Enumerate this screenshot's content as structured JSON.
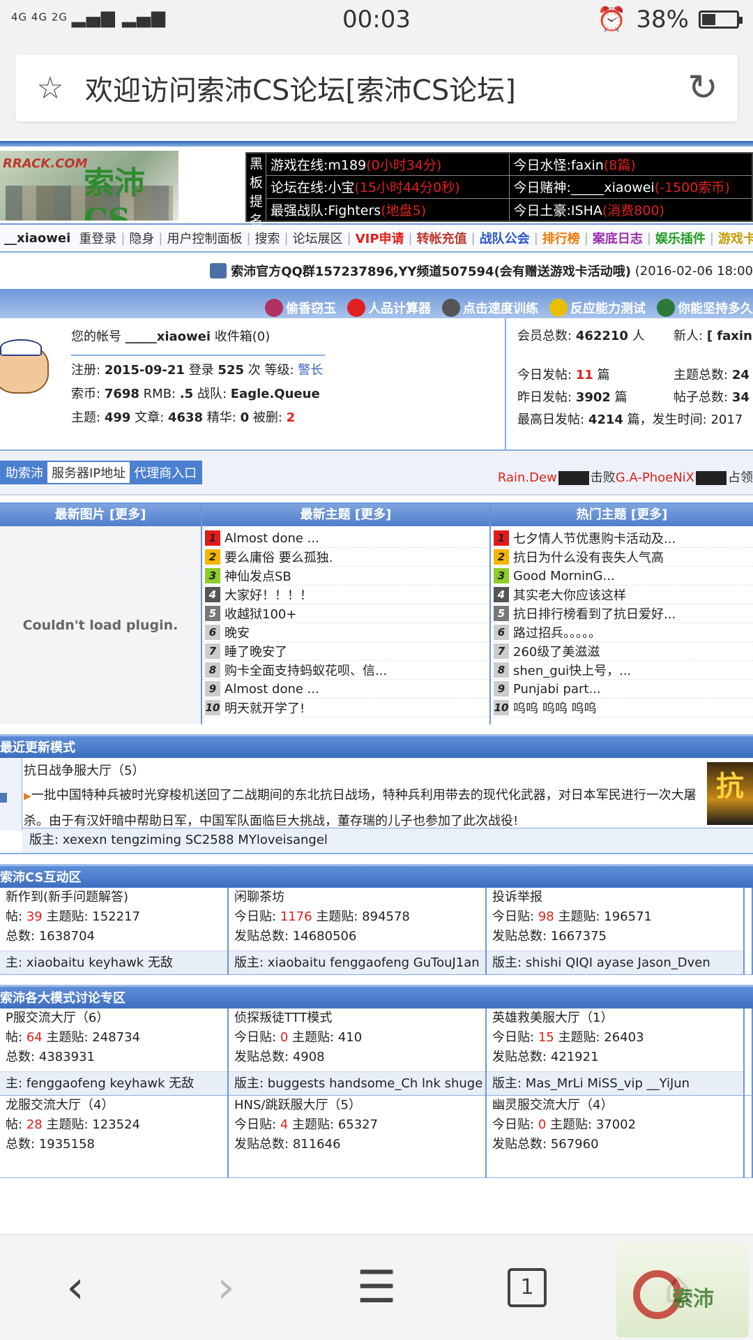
{
  "status": {
    "network": "4G 4G 2G",
    "time": "00:03",
    "battery": "38%",
    "battery_level": 0.38
  },
  "browser": {
    "title": "欢迎访问索沛CS论坛[索沛CS论坛]",
    "tab_count": "1"
  },
  "logo": {
    "url_text": "RRACK.COM",
    "name": "索沛CS"
  },
  "blackboard": {
    "label": [
      "黑",
      "板",
      "提",
      "名"
    ],
    "left": [
      {
        "k": "游戏在线:m189",
        "v": "(0小时34分)"
      },
      {
        "k": "论坛在线:小宝",
        "v": "(15小时44分0秒)"
      },
      {
        "k": "最强战队:Fighters",
        "v": "(地盘5)"
      }
    ],
    "right": [
      {
        "k": "今日水怪:faxin",
        "v": "(8篇)"
      },
      {
        "k": "今日赌神:_____xiaowei",
        "v": "(-1500索币)"
      },
      {
        "k": "今日土豪:ISHA",
        "v": "(消费800)"
      }
    ]
  },
  "nav": {
    "user": "__xiaowei",
    "items": [
      {
        "label": "重登录",
        "color": "#333333"
      },
      {
        "label": "隐身",
        "color": "#333333"
      },
      {
        "label": "用户控制面板",
        "color": "#333333"
      },
      {
        "label": "搜索",
        "color": "#333333"
      },
      {
        "label": "论坛展区",
        "color": "#333333"
      },
      {
        "label": "VIP申请",
        "color": "#e0201b"
      },
      {
        "label": "转帐充值",
        "color": "#c0392b"
      },
      {
        "label": "战队公会",
        "color": "#2a55c8"
      },
      {
        "label": "排行榜",
        "color": "#ee7a00"
      },
      {
        "label": "案底日志",
        "color": "#9b2fae"
      },
      {
        "label": "娱乐插件",
        "color": "#1e9e1e"
      },
      {
        "label": "游戏卡",
        "color": "#c8a000"
      }
    ]
  },
  "notice": {
    "text": "索沛官方QQ群157237896,YY频道507594(会有赠送游戏卡活动哦)",
    "date": "(2016-02-06 18:00"
  },
  "links": [
    "偷香窃玉",
    "人品计算器",
    "点击速度训练",
    "反应能力测试",
    "你能坚持多久"
  ],
  "account": {
    "label": "您的帐号",
    "name": "_____xiaowei",
    "inbox": "收件箱(0)",
    "reg_label": "注册:",
    "reg": "2015-09-21",
    "login_label": "登录",
    "logins": "525",
    "times_label": "次 等级:",
    "rank": "警长",
    "coin_label": "索币:",
    "coins": "7698",
    "rmb_label": "RMB:",
    "rmb": ".5",
    "team_label": "战队:",
    "team": "Eagle.Queue",
    "topics_label": "主题:",
    "topics": "499",
    "articles_label": "文章:",
    "articles": "4638",
    "elite_label": "精华:",
    "elite": "0",
    "deleted_label": "被删:",
    "deleted": "2"
  },
  "forum_stats": {
    "members_label": "会员总数:",
    "members": "462210",
    "members_unit": "人",
    "new_label": "新人:",
    "new_user": "[ faxin",
    "today_label": "今日发帖:",
    "today": "11",
    "today_unit": "篇",
    "topics_total_label": "主题总数:",
    "topics_total": "24",
    "yesterday_label": "昨日发帖:",
    "yesterday": "3902",
    "yesterday_unit": "篇",
    "posts_total_label": "帖子总数:",
    "posts_total": "34",
    "max_label": "最高日发帖:",
    "max": "4214",
    "max_unit": "篇，发生时间:",
    "max_time": "2017"
  },
  "tabs": [
    "助索沛",
    "服务器IP地址",
    "代理商入口"
  ],
  "pk": {
    "a": "Rain.Dew",
    "verb": "击败",
    "b": "G.A-PhoeNiX",
    "tail": "占领"
  },
  "latest_images": {
    "title": "最新图片 [更多]",
    "plugin": "Couldn't load plugin."
  },
  "latest_topics": {
    "title": "最新主题 [更多]",
    "items": [
      "Almost done ...",
      "要么庸俗 要么孤独.",
      "神仙发点SB",
      "大家好！！！！",
      "收越狱100+",
      "晚安",
      "睡了晚安了",
      "购卡全面支持蚂蚁花呗、信...",
      "Almost done ...",
      "明天就开学了!"
    ]
  },
  "hot_topics": {
    "title": "热门主题 [更多]",
    "items": [
      "七夕情人节优惠购卡活动及...",
      "抗日为什么没有丧失人气高",
      "Good MorninG...",
      "其实老大你应该这样",
      "抗日排行榜看到了抗日爱好...",
      "路过招兵。。。。。",
      "260级了美滋滋",
      "shen_gui快上号，...",
      "Punjabi part...",
      "呜呜 呜呜 呜呜"
    ]
  },
  "recent": {
    "title": "最近更新模式",
    "name": "抗日战争服大厅（5）",
    "desc": "一批中国特种兵被时光穿梭机送回了二战期间的东北抗日战场，特种兵利用带去的现代化武器，对日本军民进行一次大屠杀。由于有汉奸暗中帮助日军，中国军队面临巨大挑战，董存瑞的儿子也参加了此次战役!",
    "thumb": "抗",
    "mods": "版主: xexexn tengziming SC2588 MYloveisangel"
  },
  "section1": {
    "title": "索沛CS互动区",
    "cells": [
      {
        "name": "新作到(新手问题解答)",
        "today_label": "帖:",
        "today": "39",
        "topics_label": "主题贴:",
        "topics": "152217",
        "total_label": "总数:",
        "total": "1638704",
        "mods": "主: xiaobaitu keyhawk 无敌"
      },
      {
        "name": "闲聊茶坊",
        "today_label": "今日贴:",
        "today": "1176",
        "topics_label": "主题贴:",
        "topics": "894578",
        "total_label": "发贴总数:",
        "total": "14680506",
        "mods": "版主: xiaobaitu fenggaofeng GuTouJ1an"
      },
      {
        "name": "投诉举报",
        "today_label": "今日贴:",
        "today": "98",
        "topics_label": "主题贴:",
        "topics": "196571",
        "total_label": "发贴总数:",
        "total": "1667375",
        "mods": "版主: shishi QIQI ayase Jason_Dven"
      }
    ]
  },
  "section2": {
    "title": "索沛各大模式讨论专区",
    "cells": [
      {
        "name": "P服交流大厅（6）",
        "today_label": "帖:",
        "today": "64",
        "topics_label": "主题贴:",
        "topics": "248734",
        "total_label": "总数:",
        "total": "4383931",
        "mods": "主: fenggaofeng keyhawk 无敌"
      },
      {
        "name": "侦探叛徒TTT模式",
        "today_label": "今日贴:",
        "today": "0",
        "topics_label": "主题贴:",
        "topics": "410",
        "total_label": "发贴总数:",
        "total": "4908",
        "mods": "版主: buggests handsome_Ch lnk shuge"
      },
      {
        "name": "英雄救美服大厅（1）",
        "today_label": "今日贴:",
        "today": "15",
        "topics_label": "主题贴:",
        "topics": "26403",
        "total_label": "发贴总数:",
        "total": "421921",
        "mods": "版主: Mas_MrLi MiSS_vip __YiJun"
      },
      {
        "name": "龙服交流大厅（4）",
        "today_label": "帖:",
        "today": "28",
        "topics_label": "主题贴:",
        "topics": "123524",
        "total_label": "总数:",
        "total": "1935158",
        "mods": ""
      },
      {
        "name": "HNS/跳跃服大厅（5）",
        "today_label": "今日贴:",
        "today": "4",
        "topics_label": "主题贴:",
        "topics": "65327",
        "total_label": "发贴总数:",
        "total": "811646",
        "mods": ""
      },
      {
        "name": "幽灵服交流大厅（4）",
        "today_label": "今日贴:",
        "today": "0",
        "topics_label": "主题贴:",
        "topics": "37002",
        "total_label": "发贴总数:",
        "total": "567960",
        "mods": ""
      }
    ]
  }
}
